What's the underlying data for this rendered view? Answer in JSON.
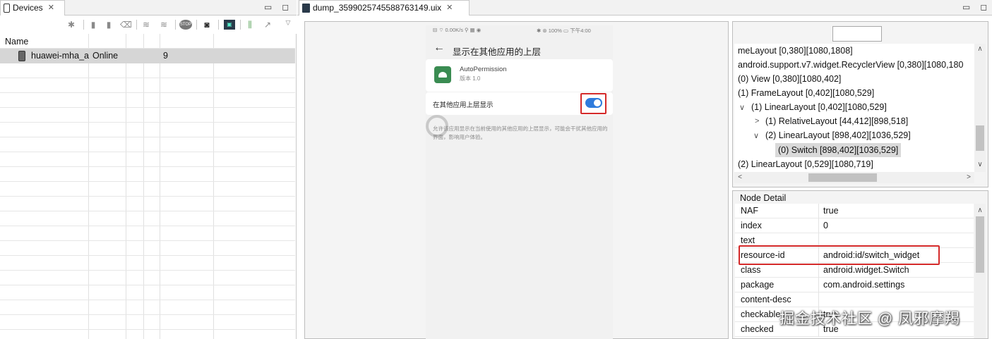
{
  "devices_panel": {
    "tab_label": "Devices",
    "column_header": "Name",
    "device": {
      "name": "huawei-mha_a",
      "status": "Online",
      "count": "9"
    }
  },
  "dump_panel": {
    "tab_label": "dump_3599025745588763149.uix"
  },
  "phone": {
    "status_left": "0.00K/s",
    "status_right": "100%",
    "status_time": "下午4:00",
    "title": "显示在其他应用的上层",
    "app_name": "AutoPermission",
    "app_version": "版本 1.0",
    "option_label": "在其他应用上层显示",
    "description": "允许该应用显示在当前使用的其他应用的上层显示，可能会干扰其他应用的界面，影响用户体验。",
    "switch_on": true
  },
  "tree": {
    "lines": [
      "meLayout [0,380][1080,1808]",
      "android.support.v7.widget.RecyclerView [0,380][1080,180",
      "(0) View [0,380][1080,402]",
      "(1) FrameLayout [0,402][1080,529]",
      "(1) LinearLayout [0,402][1080,529]",
      "(1) RelativeLayout [44,412][898,518]",
      "(2) LinearLayout [898,402][1036,529]",
      "(0) Switch [898,402][1036,529]",
      "(2) LinearLayout [0,529][1080,719]"
    ]
  },
  "node_detail": {
    "title": "Node Detail",
    "rows": [
      {
        "key": "NAF",
        "value": "true"
      },
      {
        "key": "index",
        "value": "0"
      },
      {
        "key": "text",
        "value": ""
      },
      {
        "key": "resource-id",
        "value": "android:id/switch_widget"
      },
      {
        "key": "class",
        "value": "android.widget.Switch"
      },
      {
        "key": "package",
        "value": "com.android.settings"
      },
      {
        "key": "content-desc",
        "value": ""
      },
      {
        "key": "checkable",
        "value": "true"
      },
      {
        "key": "checked",
        "value": "true"
      }
    ]
  },
  "watermark": "掘金技术社区 @ 凤邪摩羯",
  "colors": {
    "highlight_red": "#d42a2a",
    "switch_blue": "#2f7bdc",
    "selection_gray": "#d6d6d6"
  }
}
